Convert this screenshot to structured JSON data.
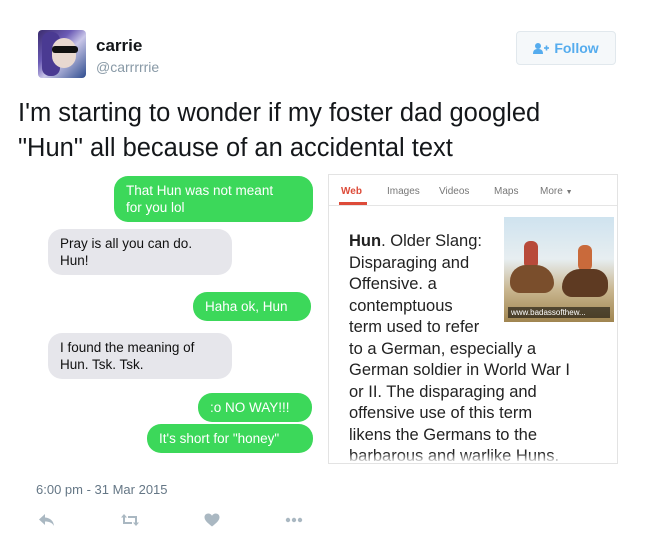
{
  "tweet": {
    "display_name": "carrie",
    "handle": "@carrrrrie",
    "follow_label": "Follow",
    "text_lines": [
      "I'm starting to wonder if my foster dad googled",
      "\"Hun\" all because of an accidental text"
    ],
    "timestamp": "6:00 pm - 31 Mar 2015"
  },
  "chat": {
    "messages": [
      {
        "from": "me",
        "lines": [
          "That Hun was not meant",
          "for you lol"
        ]
      },
      {
        "from": "them",
        "lines": [
          "Pray is all you can do.",
          "Hun!"
        ]
      },
      {
        "from": "me",
        "lines": [
          "Haha ok, Hun"
        ]
      },
      {
        "from": "them",
        "lines": [
          "I found the meaning of",
          "Hun. Tsk. Tsk."
        ]
      },
      {
        "from": "me",
        "lines": [
          ":o NO WAY!!!"
        ]
      },
      {
        "from": "me",
        "lines": [
          "It's short for \"honey\""
        ]
      }
    ]
  },
  "search": {
    "tabs": [
      "Web",
      "Images",
      "Videos",
      "Maps",
      "More"
    ],
    "active_tab": "Web",
    "definition_term": "Hun",
    "definition_lines": [
      ". Older Slang:",
      "Disparaging and",
      "Offensive. a",
      "contemptuous",
      "term used to refer",
      "to a German, especially a",
      "German soldier in World War I",
      "or II. The disparaging and",
      "offensive use of this term",
      "likens the Germans to the",
      "barbarous and warlike Huns."
    ],
    "image_caption": "www.badassofthew..."
  },
  "icons": {
    "follow": "add-user-icon",
    "reply": "reply-icon",
    "retweet": "retweet-icon",
    "like": "heart-icon",
    "more": "more-icon"
  },
  "colors": {
    "twitter_blue": "#55acee",
    "imessage_green": "#3cd85a",
    "sms_gray": "#e6e6eb",
    "google_red": "#dd4b39"
  }
}
